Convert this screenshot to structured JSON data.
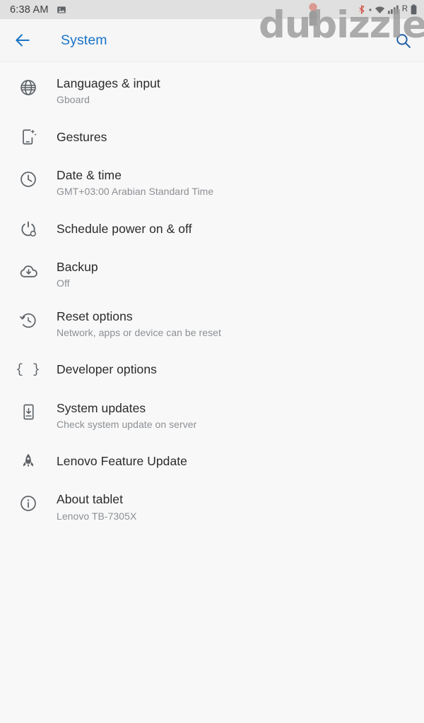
{
  "status_bar": {
    "time": "6:38 AM",
    "left_icons": [
      "image-icon"
    ],
    "right_icons": [
      "bluetooth-off-icon",
      "wifi-icon",
      "signal-bars-icon",
      "battery-icon"
    ],
    "roaming_label": "R"
  },
  "header": {
    "title": "System",
    "back_icon": "arrow-left-icon",
    "search_icon": "search-icon",
    "accent_color": "#1a73c8"
  },
  "watermark": {
    "text": "dubizzle",
    "color": "#9b9b9b"
  },
  "settings_list": [
    {
      "title": "Languages & input",
      "subtitle": "Gboard",
      "icon": "globe-icon",
      "name": "languages-and-input"
    },
    {
      "title": "Gestures",
      "subtitle": "",
      "icon": "gestures-phone-sparkle-icon",
      "name": "gestures"
    },
    {
      "title": "Date & time",
      "subtitle": "GMT+03:00 Arabian Standard Time",
      "icon": "clock-icon",
      "name": "date-and-time"
    },
    {
      "title": "Schedule power on & off",
      "subtitle": "",
      "icon": "power-schedule-icon",
      "name": "schedule-power-on-off"
    },
    {
      "title": "Backup",
      "subtitle": "Off",
      "icon": "cloud-upload-icon",
      "name": "backup"
    },
    {
      "title": "Reset options",
      "subtitle": "Network, apps or device can be reset",
      "icon": "history-restore-icon",
      "name": "reset-options"
    },
    {
      "title": "Developer options",
      "subtitle": "",
      "icon": "curly-braces-icon",
      "name": "developer-options"
    },
    {
      "title": "System updates",
      "subtitle": "Check system update on server",
      "icon": "phone-download-icon",
      "name": "system-updates"
    },
    {
      "title": "Lenovo Feature Update",
      "subtitle": "",
      "icon": "rocket-icon",
      "name": "lenovo-feature-update"
    },
    {
      "title": "About tablet",
      "subtitle": "Lenovo TB-7305X",
      "icon": "info-icon",
      "name": "about-tablet"
    }
  ]
}
